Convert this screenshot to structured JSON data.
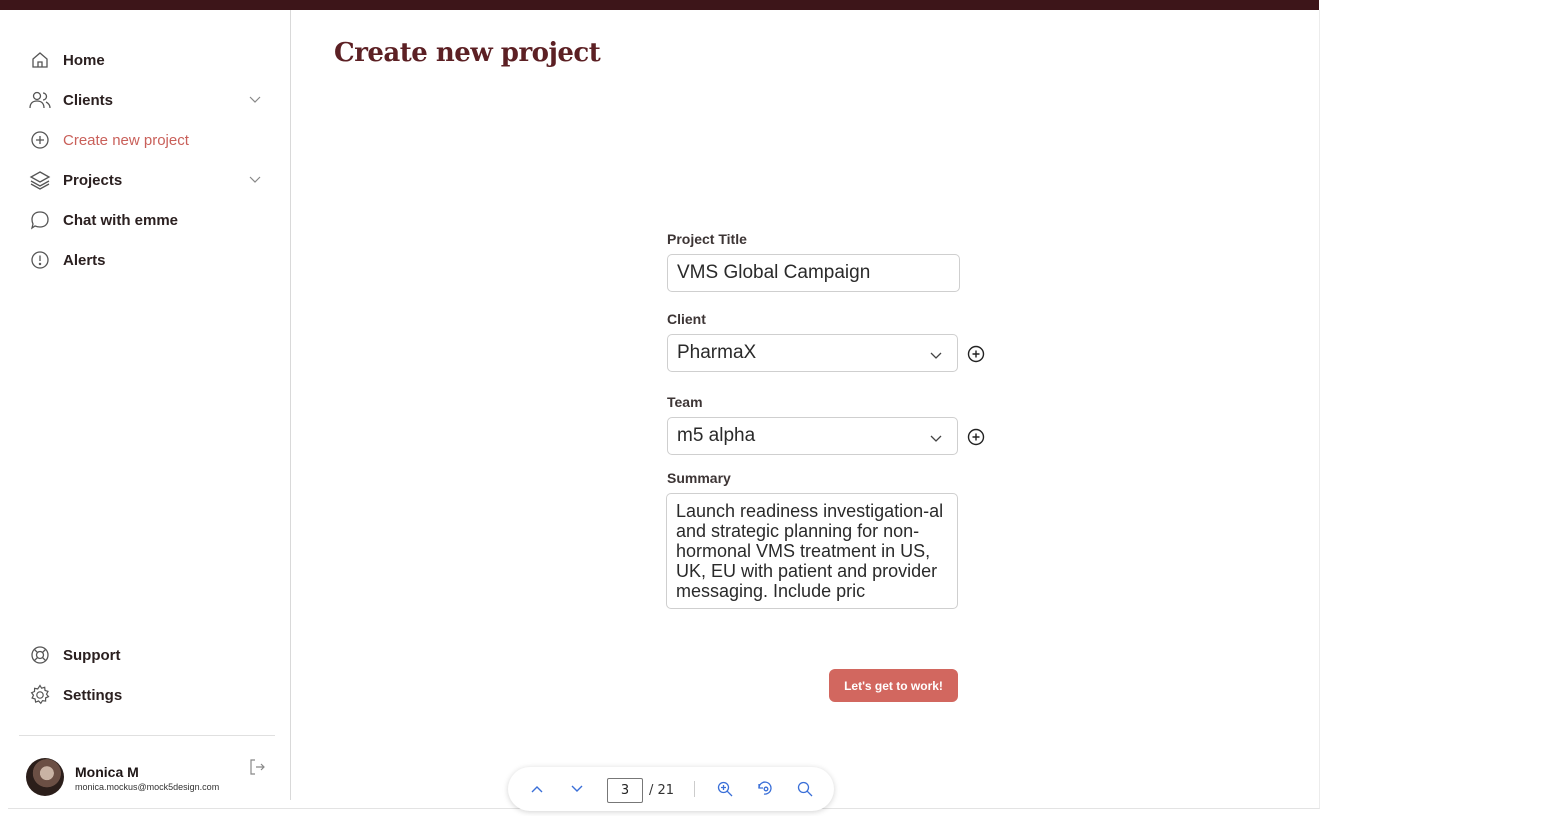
{
  "sidebar": {
    "items": [
      {
        "label": "Home",
        "icon": "home-icon"
      },
      {
        "label": "Clients",
        "icon": "users-icon",
        "expandable": true
      },
      {
        "label": "Create new project",
        "icon": "plus-circle-icon",
        "active": true
      },
      {
        "label": "Projects",
        "icon": "layers-icon",
        "expandable": true
      },
      {
        "label": "Chat with emme",
        "icon": "chat-icon"
      },
      {
        "label": "Alerts",
        "icon": "alert-icon"
      }
    ],
    "bottom_items": [
      {
        "label": "Support",
        "icon": "lifebuoy-icon"
      },
      {
        "label": "Settings",
        "icon": "gear-icon"
      }
    ],
    "user": {
      "name": "Monica M",
      "email": "monica.mockus@mock5design.com"
    }
  },
  "main": {
    "title": "Create new project",
    "form": {
      "project_title_label": "Project Title",
      "project_title_value": "VMS Global Campaign",
      "client_label": "Client",
      "client_value": "PharmaX",
      "team_label": "Team",
      "team_value": "m5 alpha",
      "summary_label": "Summary",
      "summary_value": "Launch readiness investigation-al and strategic planning for non-hormonal VMS treatment in US, UK, EU with patient and provider messaging. Include pric",
      "submit_label": "Let's get to work!"
    }
  },
  "pager": {
    "current_page": "3",
    "total": "/ 21"
  },
  "colors": {
    "brand_dark": "#3d1519",
    "accent": "#d2675f",
    "title": "#5c2024"
  }
}
